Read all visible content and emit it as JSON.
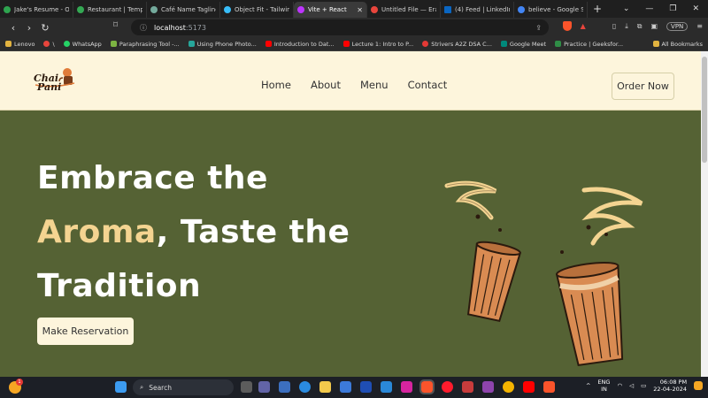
{
  "browser": {
    "tabs": [
      {
        "title": "Jake's Resume - Onli",
        "color": "#2ea44f"
      },
      {
        "title": "Restaurant | Template",
        "color": "#34a853"
      },
      {
        "title": "Café Name Tagline: C",
        "color": "#74aa9c"
      },
      {
        "title": "Object Fit - Tailwind",
        "color": "#38bdf8"
      },
      {
        "title": "Vite + React",
        "color": "#bd34fe",
        "active": true
      },
      {
        "title": "Untitled File — Erase",
        "color": "#e8453c"
      },
      {
        "title": "(4) Feed | LinkedIn",
        "color": "#0a66c2"
      },
      {
        "title": "believe - Google Sea",
        "color": "#4285f4"
      }
    ],
    "new_tab": "+",
    "url_host": "localhost",
    "url_port": ":5173",
    "vpn_label": "VPN",
    "bookmarks": [
      {
        "label": "Lenovo",
        "color": "#e2b340"
      },
      {
        "label": "\\",
        "color": "#e8453c"
      },
      {
        "label": "WhatsApp",
        "color": "#25d366"
      },
      {
        "label": "Paraphrasing Tool -...",
        "color": "#7cb342"
      },
      {
        "label": "Using Phone Photo...",
        "color": "#26a69a"
      },
      {
        "label": "Introduction to Dat...",
        "color": "#ff0000"
      },
      {
        "label": "Lecture 1: Intro to P...",
        "color": "#ff0000"
      },
      {
        "label": "Strivers A2Z DSA C...",
        "color": "#e53935"
      },
      {
        "label": "Google Meet",
        "color": "#00897b"
      },
      {
        "label": "Practice | Geeksfor...",
        "color": "#2f8d46"
      }
    ],
    "all_bookmarks": "All Bookmarks"
  },
  "site": {
    "logo_text_line1": "Chai",
    "logo_text_line2": "Pani",
    "nav": [
      "Home",
      "About",
      "Menu",
      "Contact"
    ],
    "order_button": "Order Now",
    "hero": {
      "line1": "Embrace the",
      "line2_accent": "Aroma",
      "line2_rest": ", Taste the",
      "line3": "Tradition"
    },
    "reserve_button": "Make Reservation",
    "colors": {
      "header_bg": "#fdf5dc",
      "hero_bg": "#556234",
      "accent": "#f4d491"
    }
  },
  "taskbar": {
    "search_label": "Search",
    "lang_line1": "ENG",
    "lang_line2": "IN",
    "time": "06:08 PM",
    "date": "22-04-2024",
    "notification_count": "1"
  }
}
